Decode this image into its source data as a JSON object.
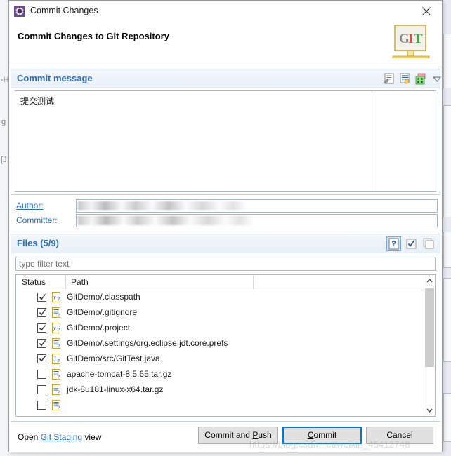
{
  "window": {
    "title": "Commit Changes",
    "icon": "eclipse-gear-icon",
    "close_label": "×"
  },
  "header": {
    "title": "Commit Changes to Git Repository",
    "logo_text_g": "G",
    "logo_text_i": "I",
    "logo_text_t": "T"
  },
  "commit_message": {
    "group_label": "Commit message",
    "value": "提交测试",
    "placeholder": "",
    "tools": [
      {
        "name": "commit-message-editor-icon",
        "title": "Open commit message editor"
      },
      {
        "name": "signed-off-by-icon",
        "title": "Add Signed-off-by"
      },
      {
        "name": "change-id-icon",
        "title": "Insert Change-Id"
      },
      {
        "name": "chevron-down-icon",
        "title": "More options"
      }
    ]
  },
  "author": {
    "label": "Author:",
    "accelerator": "A",
    "value": ""
  },
  "committer": {
    "label": "Committer:",
    "accelerator": "C",
    "value": ""
  },
  "files": {
    "group_label": "Files",
    "count_label": "(5/9)",
    "filter_placeholder": "type filter text",
    "filter_value": "",
    "tools": [
      {
        "name": "show-untracked-files-icon",
        "label": "?",
        "active": true
      },
      {
        "name": "select-all-icon",
        "label": "",
        "active": false
      },
      {
        "name": "deselect-all-icon",
        "label": "",
        "active": false
      }
    ],
    "columns": [
      "Status",
      "Path"
    ],
    "rows": [
      {
        "checked": true,
        "icon": "classpath-file-icon",
        "path": "GitDemo/.classpath"
      },
      {
        "checked": true,
        "icon": "text-file-icon",
        "path": "GitDemo/.gitignore"
      },
      {
        "checked": true,
        "icon": "classpath-file-icon",
        "path": "GitDemo/.project"
      },
      {
        "checked": true,
        "icon": "text-file-icon",
        "path": "GitDemo/.settings/org.eclipse.jdt.core.prefs"
      },
      {
        "checked": true,
        "icon": "java-file-icon",
        "path": "GitDemo/src/GitTest.java"
      },
      {
        "checked": false,
        "icon": "text-file-icon",
        "path": "apache-tomcat-8.5.65.tar.gz"
      },
      {
        "checked": false,
        "icon": "text-file-icon",
        "path": "jdk-8u181-linux-x64.tar.gz"
      },
      {
        "checked": false,
        "icon": "text-file-icon",
        "path": ""
      }
    ]
  },
  "footer": {
    "open_prefix": "Open ",
    "open_link": "Git Staging",
    "open_suffix": " view",
    "buttons": [
      {
        "name": "commit-and-push-button",
        "pre": "Commit and ",
        "accel": "P",
        "post": "ush",
        "default": false
      },
      {
        "name": "commit-button",
        "pre": "",
        "accel": "C",
        "post": "ommit",
        "default": true
      },
      {
        "name": "cancel-button",
        "pre": "Cancel",
        "accel": "",
        "post": "",
        "default": false
      }
    ]
  },
  "watermark": "https://blog.csdn.net/weixin_45412748",
  "background": {
    "left_ghosts": [
      "-H",
      "g",
      "[J"
    ]
  },
  "colors": {
    "accent_blue": "#2a6fb8",
    "group_border": "#c6d3e2",
    "default_button_outline": "#0078d7",
    "link": "#2a6fb8"
  }
}
